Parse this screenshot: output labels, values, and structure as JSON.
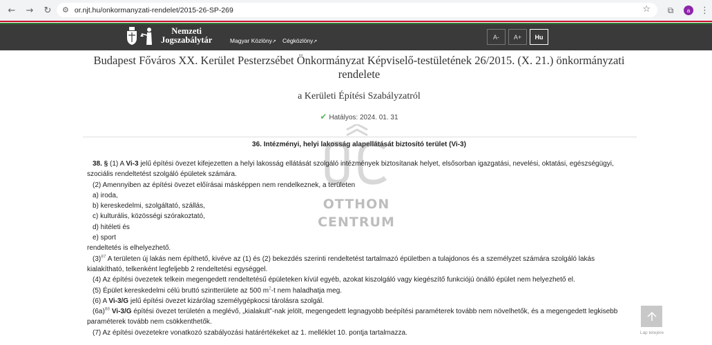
{
  "browser": {
    "url": "or.njt.hu/onkormanyzati-rendelet/2015-26-SP-269",
    "back_icon": "arrow-left-icon",
    "forward_icon": "arrow-right-icon",
    "reload_icon": "reload-icon",
    "profile_initial": "a"
  },
  "header": {
    "logo_line1": "Nemzeti",
    "logo_line2": "Jogszabálytár",
    "links": [
      "Magyar Közlöny",
      "Cégközlöny"
    ],
    "font_buttons": [
      "A-",
      "A+",
      "Hu"
    ],
    "colors": {
      "red": "#c8102e",
      "white": "#ffffff",
      "green": "#2e7d32",
      "bar": "#3a3a3a"
    }
  },
  "document": {
    "title": "Budapest Főváros XX. Kerület Pesterzsébet Önkormányzat Képviselő-testületének 26/2015. (X. 21.) önkormányzati rendelete",
    "subtitle": "a Kerületi Építési Szabályzatról",
    "effective": "Hatályos: 2024. 01. 31",
    "section_title": "36. Intézményi, helyi lakosság alapellátását biztosító terület (Vi-3)",
    "p38_num": "38. §",
    "p38_a": " (1) A ",
    "p38_zone": "Vi-3",
    "p38_b": " jelű építési övezet kifejezetten a helyi lakosság ellátását szolgáló intézmények biztosítanak helyet, elsősorban igazgatási, nevelési, oktatási, egészségügyi, szociális rendeltetést szolgáló épületek számára.",
    "p2": "(2) Amennyiben az építési övezet előírásai másképpen nem rendelkeznek, a területen",
    "list": [
      "a) iroda,",
      "b) kereskedelmi, szolgáltató, szállás,",
      "c) kulturális, közösségi szórakoztató,",
      "d) hitéleti és",
      "e) sport"
    ],
    "p2_end": "rendeltetés is elhelyezhető.",
    "p3_num": "(3)",
    "p3_sup": "87",
    "p3": " A területen új lakás nem építhető, kivéve az (1) és (2) bekezdés szerinti rendeltetést tartalmazó épületben a tulajdonos és a személyzet számára szolgáló lakás kialakítható, telkenként legfeljebb 2 rendeltetési egységgel.",
    "p4": "(4) Az építési övezetek telkein megengedett rendeltetésű épületeken kívül egyéb, azokat kiszolgáló vagy kiegészítő funkciójú önálló épület nem helyezhető el.",
    "p5_a": "(5) Épület kereskedelmi célú bruttó szintterülete az 500 m",
    "p5_sup": "2",
    "p5_b": "-t nem haladhatja meg.",
    "p6_a": "(6) A ",
    "p6_zone": "Vi-3/G",
    "p6_b": " jelű építési övezet kizárólag személygépkocsi tárolásra szolgál.",
    "p6a_num": "(6a)",
    "p6a_sup": "88",
    "p6a_zone": "Vi-3/G",
    "p6a": " építési övezet területén a meglévő, „kialakult”-nak jelölt, megengedett legnagyobb beépítési paraméterek tovább nem növelhetők, és a megengedett legkisebb paraméterek tovább nem csökkenthetők.",
    "p7": "(7) Az építési övezetekre vonatkozó szabályozási határértékeket az 1. melléklet 10. pontja tartalmazza."
  },
  "watermark": {
    "line1": "OTTHON",
    "line2": "CENTRUM"
  },
  "back_to_top": {
    "label": "Lap tetejére"
  }
}
